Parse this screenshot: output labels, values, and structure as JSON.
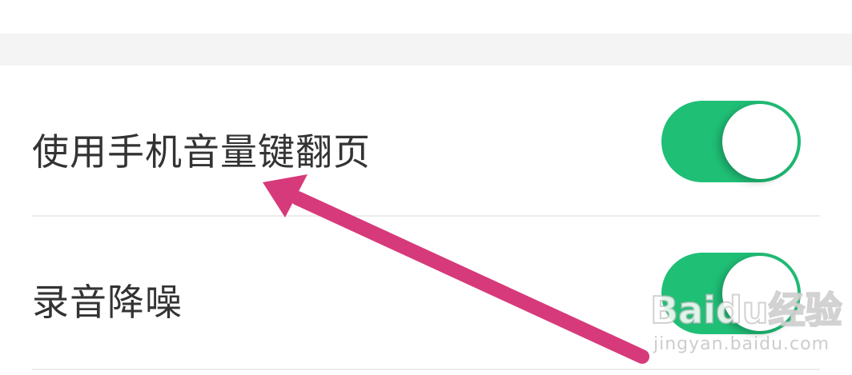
{
  "settings": {
    "items": [
      {
        "label": "使用手机音量键翻页",
        "enabled": true
      },
      {
        "label": "录音降噪",
        "enabled": true
      }
    ]
  },
  "colors": {
    "toggle_on": "#1fbf76",
    "section_gap": "#f4f4f4",
    "label_text": "#333333",
    "annotation_arrow": "#d63a7a"
  },
  "watermark": {
    "logo": "Baidu经验",
    "url": "jingyan.baidu.com"
  }
}
